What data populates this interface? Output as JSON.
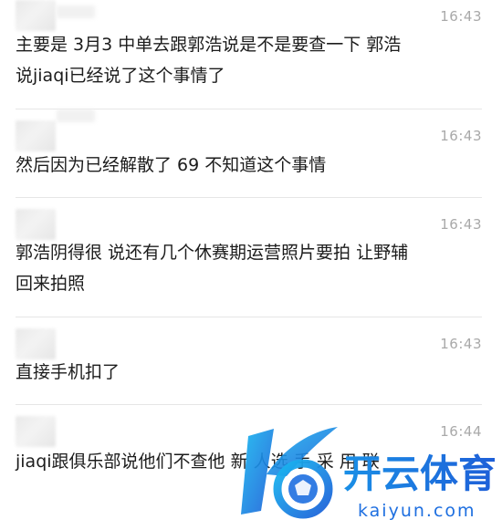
{
  "messages": [
    {
      "time": "16:43",
      "text": "主要是 3月3 中单去跟郭浩说是不是要查一下 郭浩\n说jiaqi已经说了这个事情了"
    },
    {
      "time": "16:43",
      "text": "然后因为已经解散了 69 不知道这个事情"
    },
    {
      "time": "16:43",
      "text": "郭浩阴得很 说还有几个休赛期运营照片要拍 让野辅\n回来拍照"
    },
    {
      "time": "16:43",
      "text": "直接手机扣了"
    },
    {
      "time": "16:44",
      "text": "jiaqi跟俱乐部说他们不查他 新 人选 手 采 用 联"
    }
  ],
  "watermark": {
    "brand_cn": "开云体育",
    "brand_en": "kaiyun.com",
    "icon": "kaiyun-k-logo-icon"
  },
  "colors": {
    "text": "#1c1c1c",
    "timestamp": "#a9a9a9",
    "divider": "#e6e6e6",
    "logo_blue": "#1e6fe0",
    "logo_cyan": "#19b8f0"
  }
}
